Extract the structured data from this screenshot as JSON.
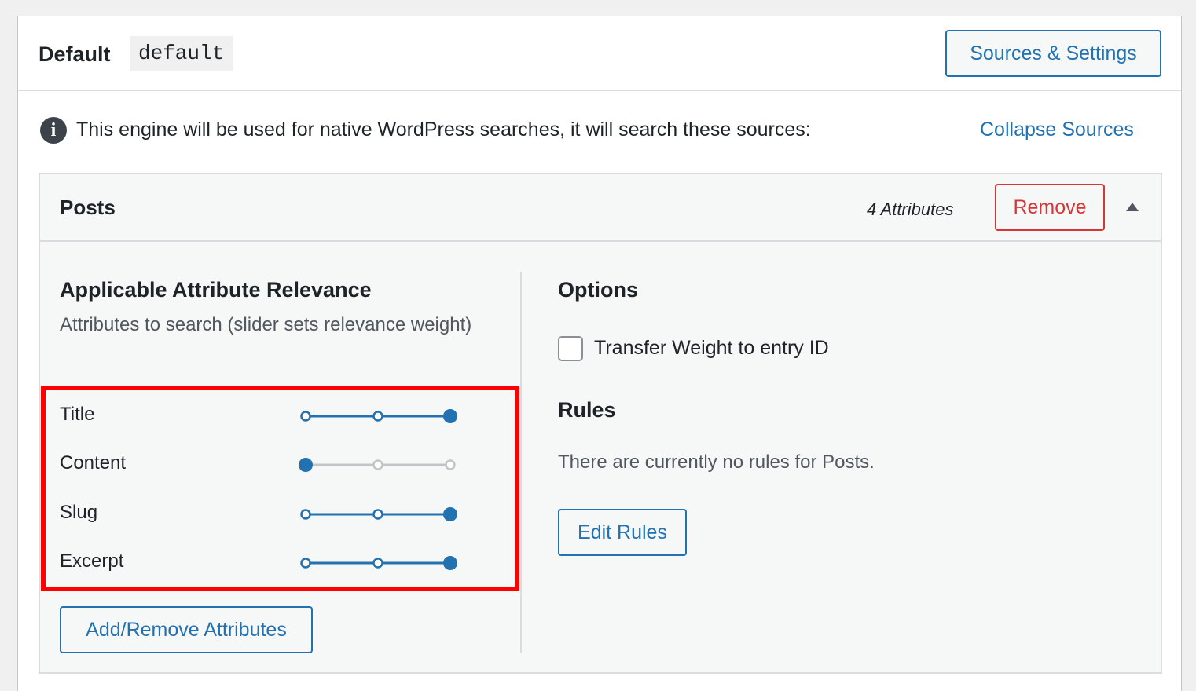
{
  "engine": {
    "title": "Default",
    "slug": "default",
    "sources_settings_label": "Sources & Settings"
  },
  "notice": {
    "icon": "info-icon",
    "icon_glyph": "i",
    "text": "This engine will be used for native WordPress searches, it will search these sources:",
    "collapse_label": "Collapse Sources"
  },
  "source": {
    "title": "Posts",
    "attribute_count": "4 Attributes",
    "remove_label": "Remove",
    "toggle_icon": "triangle-up-icon",
    "relevance": {
      "heading": "Applicable Attribute Relevance",
      "subheading": "Attributes to search (slider sets relevance weight)",
      "attributes": [
        {
          "label": "Title",
          "weight_level": 3
        },
        {
          "label": "Content",
          "weight_level": 1
        },
        {
          "label": "Slug",
          "weight_level": 3
        },
        {
          "label": "Excerpt",
          "weight_level": 3
        }
      ],
      "max_level": 3,
      "add_remove_label": "Add/Remove Attributes"
    },
    "options": {
      "heading": "Options",
      "transfer_weight_label": "Transfer Weight to entry ID",
      "transfer_weight_checked": false
    },
    "rules": {
      "heading": "Rules",
      "empty_text": "There are currently no rules for Posts.",
      "edit_label": "Edit Rules"
    }
  },
  "colors": {
    "accent": "#2271b1",
    "danger": "#d63638",
    "highlight": "#ff0000",
    "slider_inactive": "#c3c4c7"
  }
}
